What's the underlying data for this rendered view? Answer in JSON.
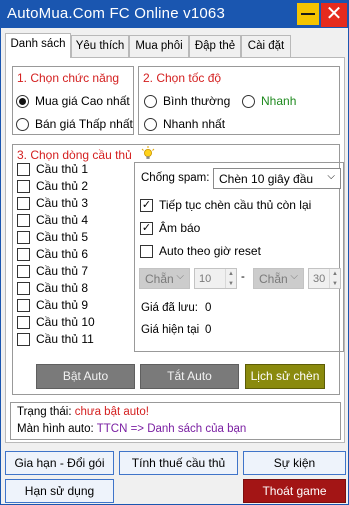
{
  "window": {
    "title": "AutoMua.Com FC Online v1063",
    "minimize_icon": "minimize-icon",
    "close_label": "✕"
  },
  "tabs": [
    {
      "label": "Danh sách",
      "active": true
    },
    {
      "label": "Yêu thích",
      "active": false
    },
    {
      "label": "Mua phôi",
      "active": false
    },
    {
      "label": "Đập thẻ",
      "active": false
    },
    {
      "label": "Cài đặt",
      "active": false
    }
  ],
  "function_group": {
    "title": "1. Chọn chức năng",
    "options": [
      {
        "label": "Mua giá Cao nhất",
        "selected": true
      },
      {
        "label": "Bán giá Thấp nhất",
        "selected": false
      }
    ]
  },
  "speed_group": {
    "title": "2. Chọn tốc độ",
    "options": [
      {
        "label": "Bình thường",
        "selected": false
      },
      {
        "label": "Nhanh",
        "selected": false,
        "color": "#1f8a1f"
      },
      {
        "label": "Nhanh nhất",
        "selected": false
      }
    ]
  },
  "player_group": {
    "title": "3. Chọn dòng cầu thủ",
    "hint_icon": "lightbulb-icon",
    "players": [
      {
        "label": "Cầu thủ 1",
        "checked": false
      },
      {
        "label": "Cầu thủ 2",
        "checked": false
      },
      {
        "label": "Cầu thủ 3",
        "checked": false
      },
      {
        "label": "Cầu thủ 4",
        "checked": false
      },
      {
        "label": "Cầu thủ 5",
        "checked": false
      },
      {
        "label": "Cầu thủ 6",
        "checked": false
      },
      {
        "label": "Cầu thủ 7",
        "checked": false
      },
      {
        "label": "Cầu thủ 8",
        "checked": false
      },
      {
        "label": "Cầu thủ 9",
        "checked": false
      },
      {
        "label": "Cầu thủ 10",
        "checked": false
      },
      {
        "label": "Cầu thủ 11",
        "checked": false
      }
    ]
  },
  "settings": {
    "spam_label": "Chống spam:",
    "spam_value": "Chèn 10 giây đầu",
    "continue_insert": {
      "label": "Tiếp tục chèn cầu thủ còn lại",
      "checked": true
    },
    "sound": {
      "label": "Âm báo",
      "checked": true
    },
    "auto_reset": {
      "label": "Auto theo giờ reset",
      "checked": false
    },
    "reset_from": {
      "parity": "Chẵn",
      "hour": "10"
    },
    "reset_dash": "-",
    "reset_to": {
      "parity": "Chẵn",
      "hour": "30"
    },
    "saved_price_label": "Giá đã lưu:",
    "saved_price_value": "0",
    "current_price_label": "Giá hiện tại",
    "current_price_value": "0"
  },
  "actions": {
    "start": "Bật Auto",
    "stop": "Tắt Auto",
    "history": "Lịch sử chèn"
  },
  "status": {
    "state_label": "Trạng thái:",
    "state_value": "chưa bật auto!",
    "screen_label": "Màn hình auto:",
    "screen_value": "TTCN => Danh sách của bạn",
    "state_color": "#d42020",
    "screen_color": "#7a1fa2"
  },
  "footer": {
    "renew": "Gia hạn - Đổi gói",
    "tax": "Tính thuế cầu thủ",
    "event": "Sự kiện",
    "expiry": "Hạn sử dụng",
    "exit": "Thoát game"
  },
  "colors": {
    "titlebar": "#1a56b0",
    "section_title": "#d42020",
    "exit_button": "#a31515"
  }
}
